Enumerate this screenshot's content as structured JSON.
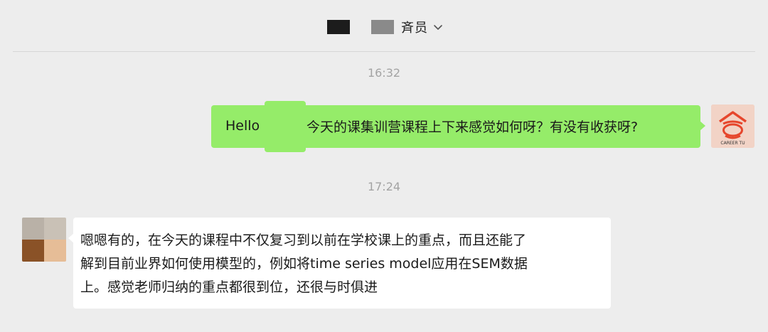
{
  "header": {
    "title": "斉员",
    "chevron_icon": "chevron-down-icon"
  },
  "timestamps": [
    "16:32",
    "17:24"
  ],
  "messages": {
    "sent": {
      "prefix": "Hello",
      "text": "今天的课集训营课程上下来感觉如何呀？有没有收获呀?",
      "avatar_text": "CAREER TU"
    },
    "received": {
      "lines": [
        "嗯嗯有的，在今天的课程中不仅复习到以前在学校课上的重点，而且还能了",
        "解到目前业界如何使用模型的，例如将time series model应用在SEM数据",
        "上。感觉老师归纳的重点都很到位，还很与时俱进"
      ]
    }
  },
  "colors": {
    "background": "#ededed",
    "sent_bubble": "#95ec69",
    "received_bubble": "#ffffff",
    "timestamp": "#a3a3a3"
  }
}
